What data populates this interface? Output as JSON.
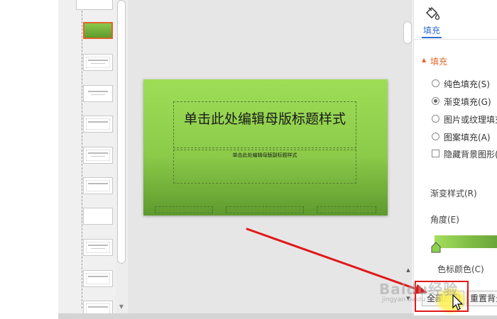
{
  "slide": {
    "title": "单击此处编辑母版标题样式",
    "subtitle": "单击此处编辑母版副标题样式",
    "footer_left": "",
    "footer_center": "",
    "footer_right": ""
  },
  "panel": {
    "tab_label": "填充",
    "section_label": "填充",
    "options": [
      {
        "label": "纯色填充(S)",
        "selected": false
      },
      {
        "label": "渐变填充(G)",
        "selected": true
      },
      {
        "label": "图片或纹理填充",
        "selected": false
      },
      {
        "label": "图案填充(A)",
        "selected": false
      }
    ],
    "hide_bg_label": "隐藏背景图形(",
    "gradient_style_label": "渐变样式(R)",
    "angle_label": "角度(E)",
    "stop_color_label": "色标颜色(C)",
    "apply_all_label": "全部应用",
    "reset_bg_label": "重置背景"
  },
  "watermark": {
    "line1": "Baidu经验",
    "line2": "jingyan.baidu.com"
  },
  "colors": {
    "accent": "#2e6fd2",
    "section": "#e06a2a",
    "highlight": "#e01818",
    "slide_top": "#9ddd56",
    "slide_bottom": "#5e9a2e"
  }
}
